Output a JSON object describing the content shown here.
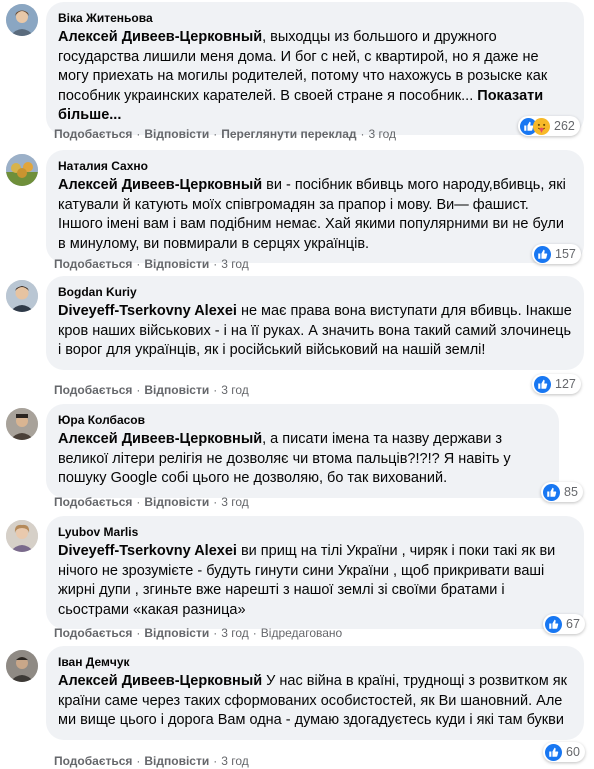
{
  "colors": {
    "like": "#1877f2",
    "meta": "#65676b",
    "bubble": "#f0f2f5"
  },
  "comments": [
    {
      "author": "Віка Житеньова",
      "mention": "Алексей Дивеев-Церковный",
      "text": ", выходцы из большого и дружного государства лишили меня дома. И бог с ней, с квартирой, но я даже не могу приехать на могилы родителей, потому что нахожусь в розыске как пособник украинских карателей. В своей стране я пособник...",
      "see_more": "Показати більше...",
      "like_label": "Подобається",
      "reply_label": "Відповісти",
      "translate_label": "Переглянути переклад",
      "time": "3 год",
      "reactions": [
        "like-icon",
        "care-icon"
      ],
      "reaction_count": "262"
    },
    {
      "author": "Наталия Сахно",
      "mention": "Алексей Дивеев-Церковный",
      "text": "ви - посібник вбивць мого народу,вбивць, які катували й катують моїх співгромадян за прапор і мову. Ви— фашист. Іншого імені вам і вам подібним немає. Хай якими популярними ви не були в минулому, ви повмирали в серцях українців.",
      "like_label": "Подобається",
      "reply_label": "Відповісти",
      "time": "3 год",
      "reactions": [
        "like-icon"
      ],
      "reaction_count": "157"
    },
    {
      "author": "Bogdan Kuriy",
      "mention": "Diveyeff-Tserkovny Alexei",
      "text": "не має права вона виступати для вбивць. Інакше кров наших військових - і на її руках. А значить вона такий самий злочинець і ворог для українців, як і російський військовий на нашій землі!",
      "like_label": "Подобається",
      "reply_label": "Відповісти",
      "time": "3 год",
      "reactions": [
        "like-icon"
      ],
      "reaction_count": "127"
    },
    {
      "author": "Юра Колбасов",
      "mention": "Алексей Дивеев-Церковный",
      "text": ", а писати імена та назву держави з великої літери релігія не дозволяє чи втома пальців?!?!? Я навіть у пошуку Google собі цього не дозволяю, бо так вихований.",
      "like_label": "Подобається",
      "reply_label": "Відповісти",
      "time": "3 год",
      "reactions": [
        "like-icon"
      ],
      "reaction_count": "85"
    },
    {
      "author": "Lyubov Marlis",
      "mention": "Diveyeff-Tserkovny Alexei",
      "text": "ви прищ на тілі України , чиряк і поки такі як ви нічого не зрозумієте - будуть гинути сини України , щоб прикривати ваші жирні дупи , згиньте вже нарешті з нашої землі зі своїми братами і сьострами «какая разница»",
      "like_label": "Подобається",
      "reply_label": "Відповісти",
      "time": "3 год",
      "edited_label": "Відредаговано",
      "reactions": [
        "like-icon"
      ],
      "reaction_count": "67"
    },
    {
      "author": "Іван Демчук",
      "mention": "Алексей Дивеев-Церковный",
      "text": "У нас війна в країні, труднощі з розвитком як країни саме через таких сформованих особистостей, як Ви шановний. Але ми вище цього і дорога Вам одна - думаю здогадуєтесь куди і які там букви",
      "like_label": "Подобається",
      "reply_label": "Відповісти",
      "time": "3 год",
      "reactions": [
        "like-icon"
      ],
      "reaction_count": "60"
    }
  ]
}
